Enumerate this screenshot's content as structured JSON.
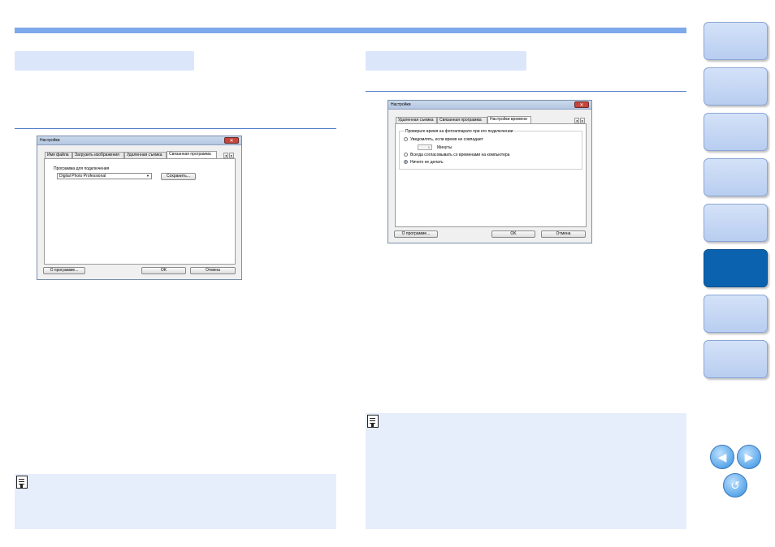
{
  "left_dialog": {
    "title": "Настройки",
    "tabs": [
      "Имя файла",
      "Загрузить изображения",
      "Удаленная съемка",
      "Связанная программа"
    ],
    "active_tab": "Связанная программа",
    "program_label": "Программа для подключения",
    "program_value": "Digital Photo Professional",
    "register_button": "Сохранить...",
    "about_button": "О программе...",
    "ok_button": "OK",
    "cancel_button": "Отмена"
  },
  "right_dialog": {
    "title": "Настройки",
    "tabs": [
      "Удаленная съемка",
      "Связанная программа",
      "Настройки времени"
    ],
    "active_tab": "Настройки времени",
    "group_label": "Проверьте время на фотоаппарате при его подключении",
    "option1": "Уведомлять, если время не совпадает",
    "minutes_value": "5",
    "minutes_label": "Минуты",
    "option2": "Всегда согласовывать со временами на компьютера",
    "option3": "Ничего не делать",
    "about_button": "О программе...",
    "ok_button": "OK",
    "cancel_button": "Отмена"
  },
  "colors": {
    "accent": "#7ea9ea",
    "nav_active": "#0b63b0",
    "note_bg": "#e6eefc"
  },
  "nav": {
    "tab_count": 8,
    "active_index": 5
  },
  "icons": {
    "prev": "prev-page-icon",
    "next": "next-page-icon",
    "back": "return-icon",
    "note": "note-icon"
  }
}
